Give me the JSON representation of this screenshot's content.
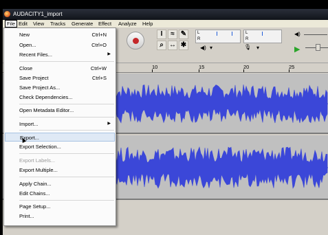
{
  "window": {
    "title": "AUDACITY1_import"
  },
  "menubar": {
    "items": [
      "File",
      "Edit",
      "View",
      "Tracks",
      "Generate",
      "Effect",
      "Analyze",
      "Help"
    ]
  },
  "meters": {
    "left_label": "L",
    "right_label": "R"
  },
  "ruler": {
    "ticks": [
      "10",
      "15",
      "20",
      "25"
    ]
  },
  "file_menu": {
    "items": [
      {
        "label": "New",
        "shortcut": "Ctrl+N"
      },
      {
        "label": "Open...",
        "shortcut": "Ctrl+O"
      },
      {
        "label": "Recent Files...",
        "shortcut": ""
      },
      {
        "label": "Close",
        "shortcut": "Ctrl+W"
      },
      {
        "label": "Save Project",
        "shortcut": "Ctrl+S"
      },
      {
        "label": "Save Project As...",
        "shortcut": ""
      },
      {
        "label": "Check Dependencies...",
        "shortcut": ""
      },
      {
        "label": "Open Metadata Editor...",
        "shortcut": ""
      },
      {
        "label": "Import...",
        "shortcut": ""
      },
      {
        "label": "Export...",
        "shortcut": ""
      },
      {
        "label": "Export Selection...",
        "shortcut": ""
      },
      {
        "label": "Export Labels...",
        "shortcut": ""
      },
      {
        "label": "Export Multiple...",
        "shortcut": ""
      },
      {
        "label": "Apply Chain...",
        "shortcut": ""
      },
      {
        "label": "Edit Chains...",
        "shortcut": ""
      },
      {
        "label": "Page Setup...",
        "shortcut": ""
      },
      {
        "label": "Print...",
        "shortcut": ""
      }
    ]
  },
  "colors": {
    "waveform": "#3b47d8",
    "track_bg": "#c0c0c0",
    "menu_hover": "#dfe9f5"
  }
}
